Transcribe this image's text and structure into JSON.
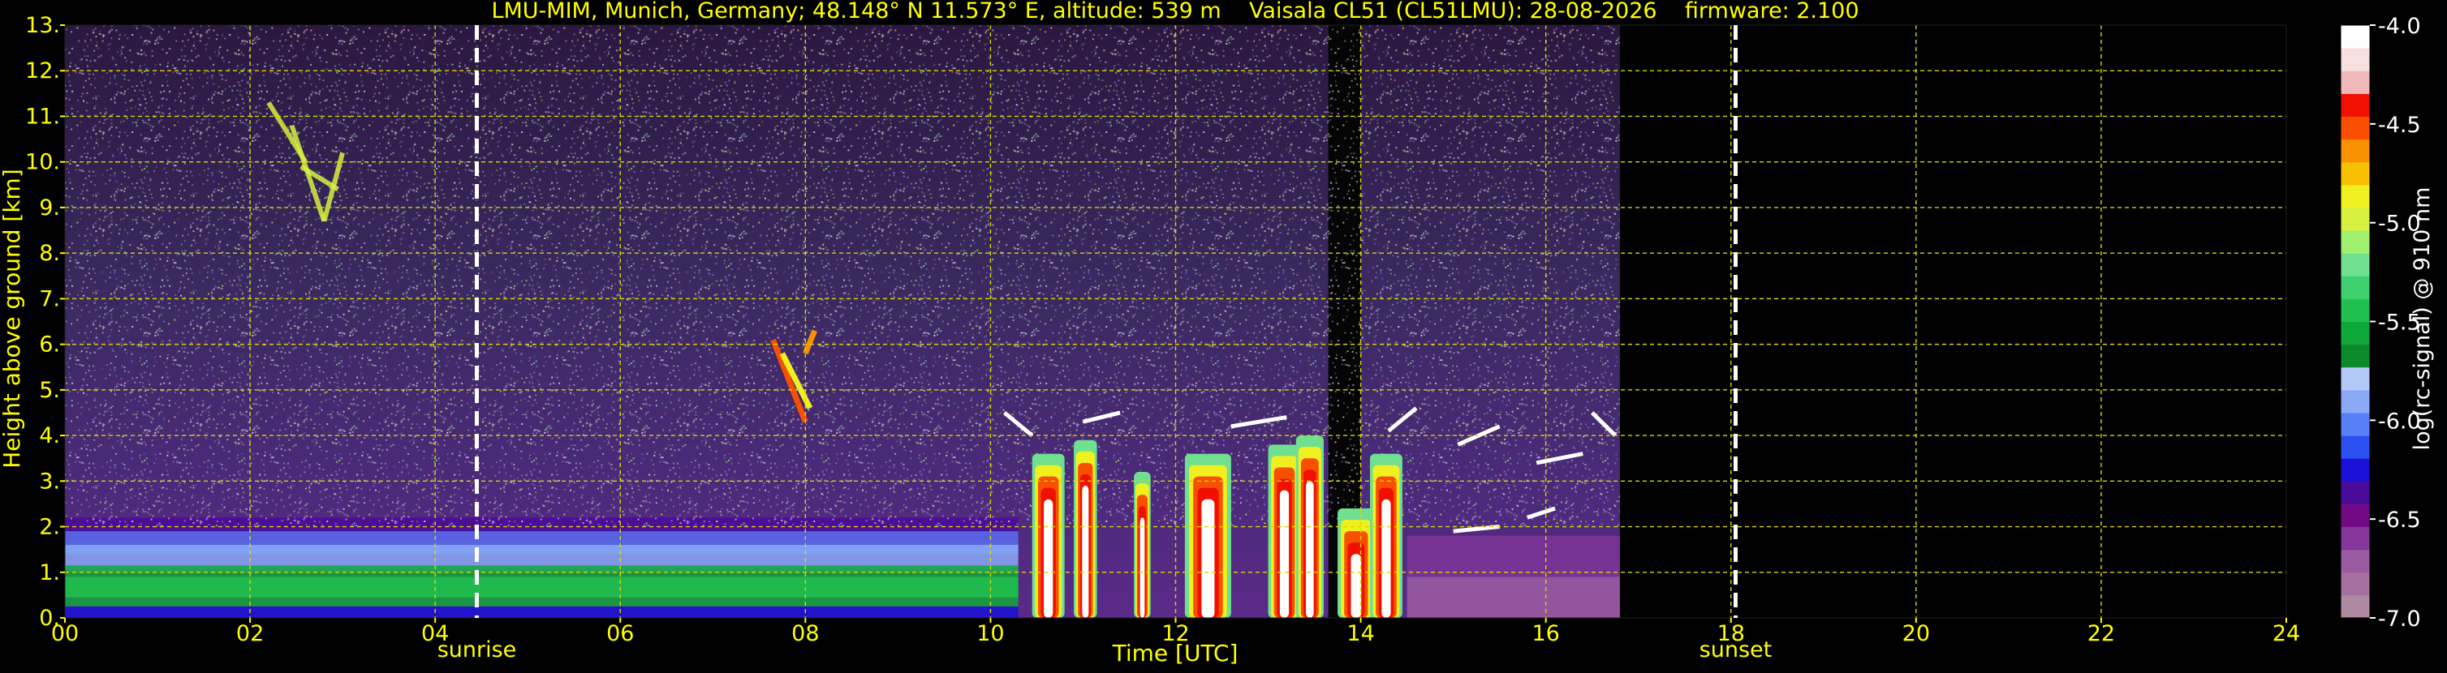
{
  "chart_data": {
    "type": "heatmap",
    "title": "LMU-MIM, Munich, Germany; 48.148° N 11.573° E, altitude: 539 m    Vaisala CL51 (CL51LMU): 28-08-2026    firmware: 2.100",
    "xlabel": "Time [UTC]",
    "ylabel": "Height above ground [km]",
    "colorbar_label": "log(rc-signal) @ 910 nm",
    "xlim": [
      0,
      24
    ],
    "ylim": [
      0,
      13
    ],
    "x_ticks": [
      {
        "v": 0,
        "label": "00"
      },
      {
        "v": 2,
        "label": "02"
      },
      {
        "v": 4,
        "label": "04"
      },
      {
        "v": 6,
        "label": "06"
      },
      {
        "v": 8,
        "label": "08"
      },
      {
        "v": 10,
        "label": "10"
      },
      {
        "v": 12,
        "label": "12"
      },
      {
        "v": 14,
        "label": "14"
      },
      {
        "v": 16,
        "label": "16"
      },
      {
        "v": 18,
        "label": "18"
      },
      {
        "v": 20,
        "label": "20"
      },
      {
        "v": 22,
        "label": "22"
      },
      {
        "v": 24,
        "label": "24"
      }
    ],
    "y_ticks": [
      {
        "v": 0,
        "label": "0."
      },
      {
        "v": 1,
        "label": "1."
      },
      {
        "v": 2,
        "label": "2."
      },
      {
        "v": 3,
        "label": "3."
      },
      {
        "v": 4,
        "label": "4."
      },
      {
        "v": 5,
        "label": "5."
      },
      {
        "v": 6,
        "label": "6."
      },
      {
        "v": 7,
        "label": "7."
      },
      {
        "v": 8,
        "label": "8."
      },
      {
        "v": 9,
        "label": "9."
      },
      {
        "v": 10,
        "label": "10."
      },
      {
        "v": 11,
        "label": "11."
      },
      {
        "v": 12,
        "label": "12."
      },
      {
        "v": 13,
        "label": "13."
      }
    ],
    "grid": true,
    "colorbar": {
      "range": [
        -7.0,
        -4.0
      ],
      "ticks": [
        {
          "v": -4.0,
          "label": "-4.0"
        },
        {
          "v": -4.5,
          "label": "-4.5"
        },
        {
          "v": -5.0,
          "label": "-5.0"
        },
        {
          "v": -5.5,
          "label": "-5.5"
        },
        {
          "v": -6.0,
          "label": "-6.0"
        },
        {
          "v": -6.5,
          "label": "-6.5"
        },
        {
          "v": -7.0,
          "label": "-7.0"
        }
      ],
      "colors_low_to_high": [
        "#b08aa0",
        "#a570a0",
        "#9a5aa0",
        "#86369a",
        "#720a86",
        "#4a0a9a",
        "#1a10d8",
        "#2a50f0",
        "#5a80f8",
        "#8aaaf8",
        "#b4c8f8",
        "#0a8a2a",
        "#10a838",
        "#20c050",
        "#40d070",
        "#70e090",
        "#a0f070",
        "#d8f040",
        "#f0f020",
        "#f8c000",
        "#f89000",
        "#f85000",
        "#f01000",
        "#f0b8b8",
        "#f8e0e0",
        "#ffffff"
      ]
    },
    "data_end_hour": 16.8,
    "annotations": [
      {
        "label": "sunrise",
        "hour": 4.45
      },
      {
        "label": "sunset",
        "hour": 18.05
      }
    ],
    "layers": [
      {
        "name": "boundary layer",
        "t0": 0,
        "t1": 16.8,
        "top_km": 2.2
      },
      {
        "name": "cirrus",
        "t0": 2.2,
        "t1": 3.0,
        "base_km": 8.6,
        "top_km": 11.5
      },
      {
        "name": "cloud",
        "t0": 7.6,
        "t1": 8.1,
        "base_km": 4.3,
        "top_km": 6.3
      },
      {
        "name": "convective cloud",
        "t0": 10.4,
        "t1": 14.5,
        "base_km": 0,
        "top_km": 4.5
      },
      {
        "name": "cloud base",
        "t0": 15.0,
        "t1": 16.8,
        "base_km": 1.8,
        "top_km": 4.5
      }
    ]
  }
}
